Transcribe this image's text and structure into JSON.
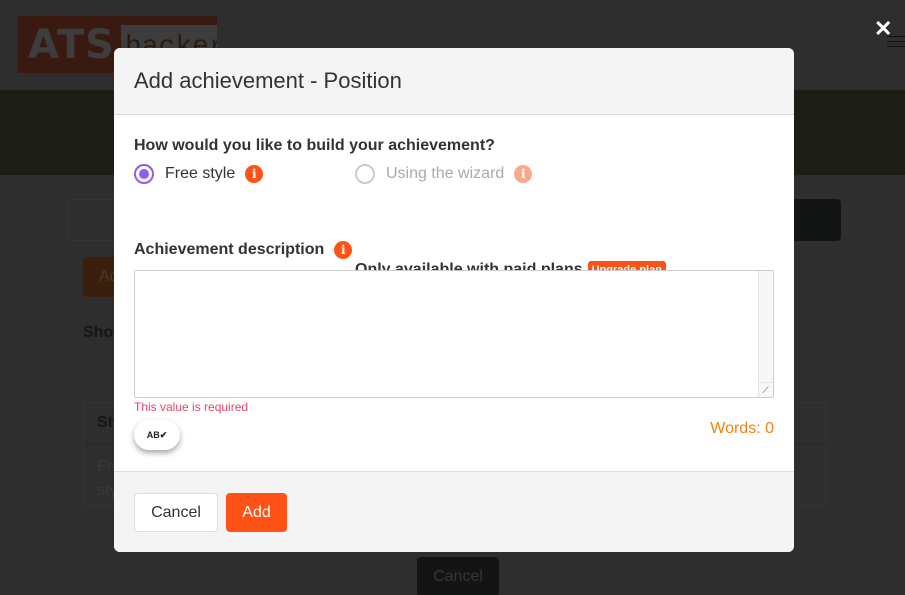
{
  "background": {
    "logo": {
      "primary": "ATS",
      "secondary": "hacker"
    },
    "close_icon": "close-icon",
    "menu_icon": "hamburger-icon",
    "action_button_label": "Ad",
    "show_label": "Sho",
    "table": {
      "header": "Sty",
      "cell": "Free style"
    },
    "cancel_label": "Cancel"
  },
  "modal": {
    "title": "Add achievement - Position",
    "question": "How would you like to build your achievement?",
    "options": [
      {
        "label": "Free style",
        "selected": true,
        "enabled": true,
        "info_icon": "info-icon"
      },
      {
        "label": "Using the wizard",
        "selected": false,
        "enabled": false,
        "info_icon": "info-icon"
      }
    ],
    "paid_note": "Only available with paid plans",
    "upgrade_badge": "Upgrade plan",
    "description_label": "Achievement description",
    "description_value": "",
    "error_text": "This value is required",
    "spellcheck_icon": "AB",
    "words_count": "Words: 0",
    "footer": {
      "cancel_label": "Cancel",
      "add_label": "Add"
    }
  },
  "colors": {
    "accent": "#ff5216",
    "radio_selected": "#8b5cf6",
    "error": "#e5456a",
    "words": "#f7810e"
  }
}
